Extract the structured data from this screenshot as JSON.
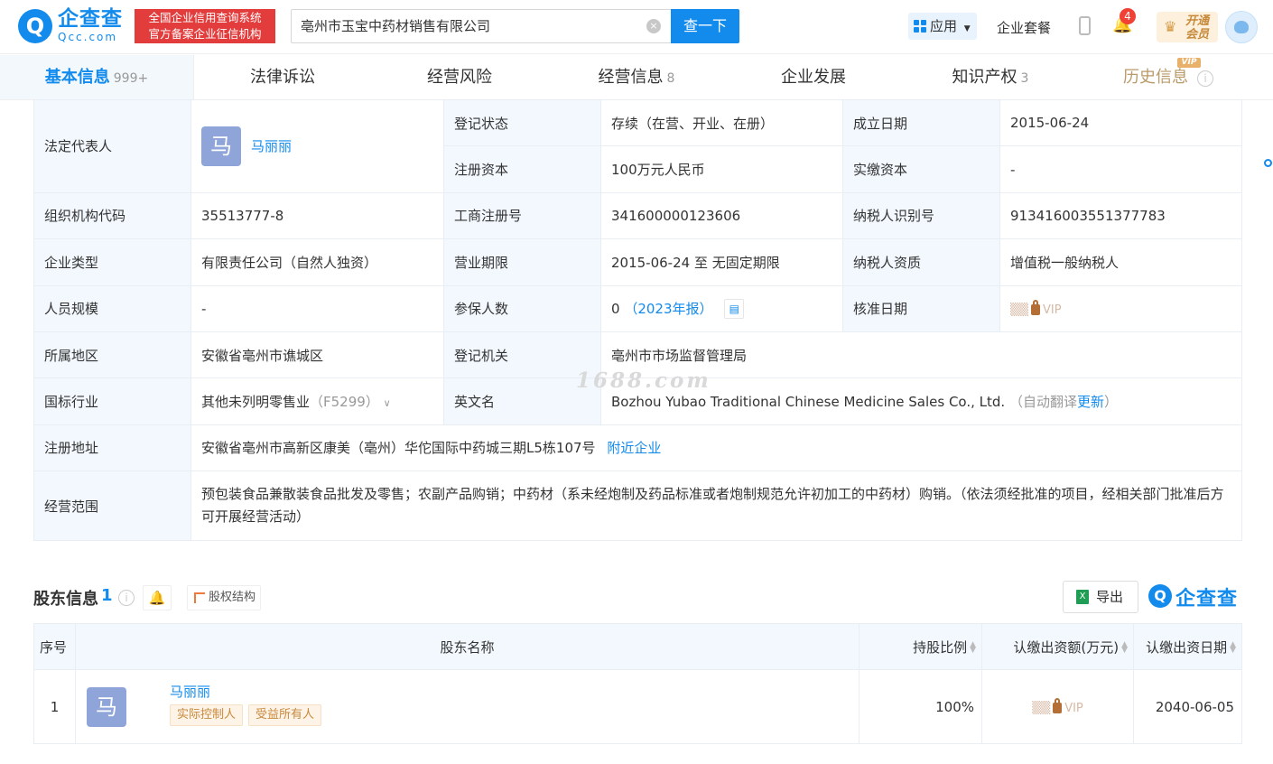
{
  "header": {
    "logo_cn": "企查查",
    "logo_en": "Qcc.com",
    "slogan_line1": "全国企业信用查询系统",
    "slogan_line2": "官方备案企业征信机构",
    "search_value": "亳州市玉宝中药材销售有限公司",
    "search_button": "查一下",
    "apps_label": "应用",
    "suite_label": "企业套餐",
    "notification_count": "4",
    "vip_line1": "开通",
    "vip_line2": "会员"
  },
  "tabs": [
    {
      "label": "基本信息",
      "count": "999+"
    },
    {
      "label": "法律诉讼",
      "count": ""
    },
    {
      "label": "经营风险",
      "count": ""
    },
    {
      "label": "经营信息",
      "count": "8"
    },
    {
      "label": "企业发展",
      "count": ""
    },
    {
      "label": "知识产权",
      "count": "3"
    },
    {
      "label": "历史信息",
      "count": ""
    }
  ],
  "vip_tag": "VIP",
  "info": {
    "legal_rep_label": "法定代表人",
    "legal_rep_avatar": "马",
    "legal_rep_name": "马丽丽",
    "reg_status_label": "登记状态",
    "reg_status": "存续（在营、开业、在册）",
    "found_date_label": "成立日期",
    "found_date": "2015-06-24",
    "reg_capital_label": "注册资本",
    "reg_capital": "100万元人民币",
    "paid_capital_label": "实缴资本",
    "paid_capital": "-",
    "org_code_label": "组织机构代码",
    "org_code": "35513777-8",
    "biz_reg_no_label": "工商注册号",
    "biz_reg_no": "341600000123606",
    "taxpayer_id_label": "纳税人识别号",
    "taxpayer_id": "913416003551377783",
    "company_type_label": "企业类型",
    "company_type": "有限责任公司（自然人独资）",
    "biz_term_label": "营业期限",
    "biz_term": "2015-06-24 至 无固定期限",
    "taxpayer_qual_label": "纳税人资质",
    "taxpayer_qual": "增值税一般纳税人",
    "staff_size_label": "人员规模",
    "staff_size": "-",
    "insured_label": "参保人数",
    "insured": "0",
    "insured_year": "（2023年报）",
    "approve_date_label": "核准日期",
    "approve_date_lock": "VIP",
    "region_label": "所属地区",
    "region": "安徽省亳州市谯城区",
    "reg_authority_label": "登记机关",
    "reg_authority": "亳州市市场监督管理局",
    "industry_label": "国标行业",
    "industry": "其他未列明零售业",
    "industry_code": "（F5299）",
    "english_name_label": "英文名",
    "english_name": "Bozhou Yubao Traditional Chinese Medicine Sales Co., Ltd.",
    "auto_translate": "（自动翻译",
    "update_link": "更新",
    "close_paren": "）",
    "address_label": "注册地址",
    "address": "安徽省亳州市高新区康美（亳州）华佗国际中药城三期L5栋107号",
    "nearby_link": "附近企业",
    "scope_label": "经营范围",
    "scope": "预包装食品兼散装食品批发及零售；农副产品购销；中药材（系未经炮制及药品标准或者炮制规范允许初加工的中药材）购销。（依法须经批准的项目，经相关部门批准后方可开展经营活动）"
  },
  "watermark": "1688.com",
  "shareholders": {
    "title": "股东信息",
    "count": "1",
    "struct_label": "股权结构",
    "export_label": "导出",
    "brand": "企查查",
    "columns": [
      "序号",
      "股东名称",
      "持股比例",
      "认缴出资额(万元)",
      "认缴出资日期"
    ],
    "rows": [
      {
        "index": "1",
        "avatar": "马",
        "name": "马丽丽",
        "tags": [
          "实际控制人",
          "受益所有人"
        ],
        "ratio": "100%",
        "amount_lock": "VIP",
        "date": "2040-06-05"
      }
    ]
  }
}
